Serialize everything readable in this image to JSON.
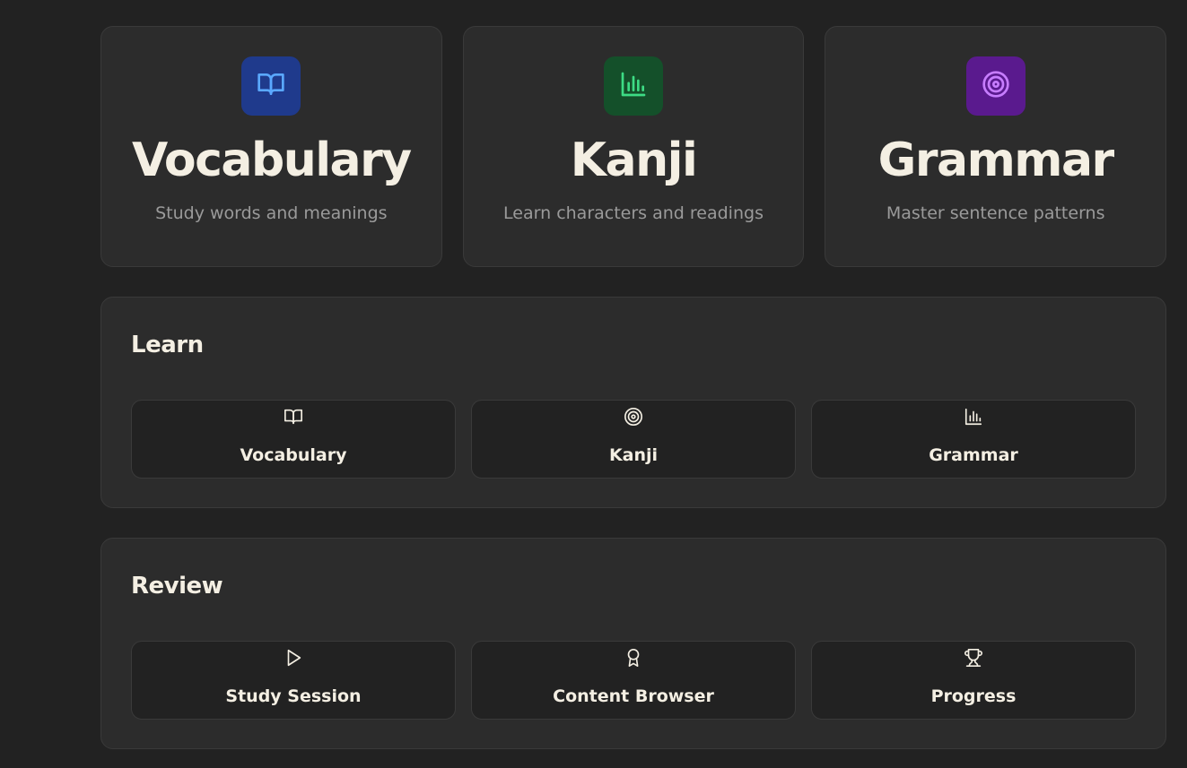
{
  "stat_cards": [
    {
      "title": "Vocabulary",
      "subtitle": "Study words and meanings",
      "icon": "book-open-icon",
      "accent_bg": "#1f3a8c",
      "accent_fg": "#5aa8ff"
    },
    {
      "title": "Kanji",
      "subtitle": "Learn characters and readings",
      "icon": "bar-chart-icon",
      "accent_bg": "#14502a",
      "accent_fg": "#3ddc84"
    },
    {
      "title": "Grammar",
      "subtitle": "Master sentence patterns",
      "icon": "target-icon",
      "accent_bg": "#5a1a8e",
      "accent_fg": "#c77dff"
    }
  ],
  "learn": {
    "title": "Learn",
    "buttons": [
      {
        "label": "Vocabulary",
        "icon": "book-open-icon"
      },
      {
        "label": "Kanji",
        "icon": "target-icon"
      },
      {
        "label": "Grammar",
        "icon": "bar-chart-icon"
      }
    ]
  },
  "review": {
    "title": "Review",
    "buttons": [
      {
        "label": "Study Session",
        "icon": "play-icon"
      },
      {
        "label": "Content Browser",
        "icon": "award-icon"
      },
      {
        "label": "Progress",
        "icon": "trophy-icon"
      }
    ]
  },
  "colors": {
    "background": "#222222",
    "card": "#2c2c2c",
    "text": "#f4efe3",
    "muted": "#9a9a9a"
  }
}
